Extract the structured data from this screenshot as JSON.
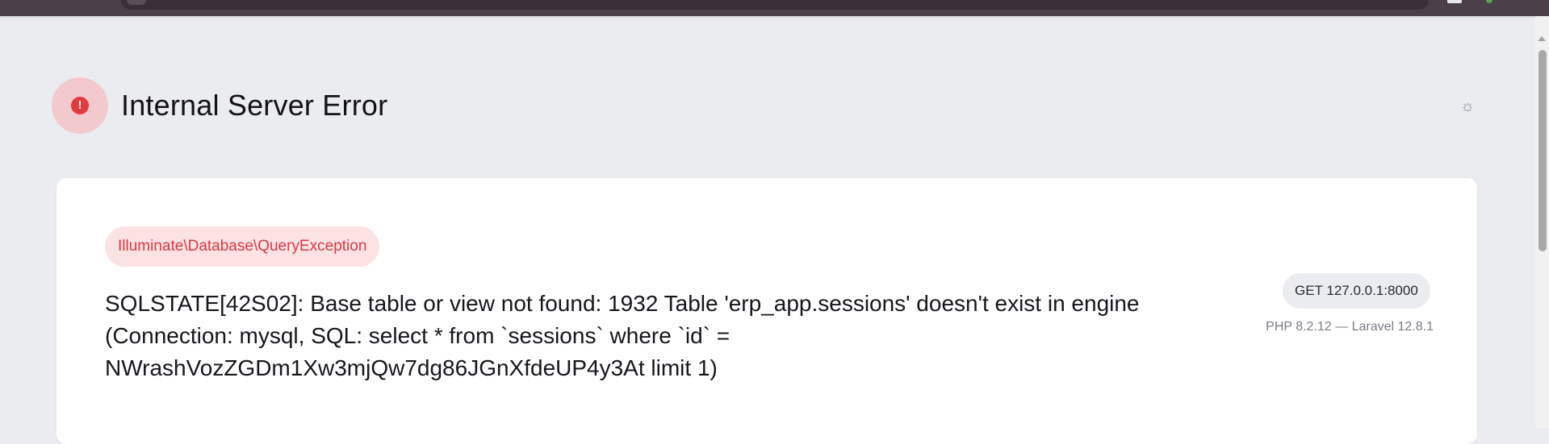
{
  "header": {
    "title": "Internal Server Error",
    "status_icon": "exclamation-icon",
    "status_glyph": "!",
    "theme_icon": "sun-icon",
    "theme_glyph": "☼"
  },
  "exception": {
    "class": "Illuminate\\Database\\QueryException",
    "message": "SQLSTATE[42S02]: Base table or view not found: 1932 Table 'erp_app.sessions' doesn't exist in engine (Connection: mysql, SQL: select * from `sessions` where `id` = NWrashVozZGDm1Xw3mjQw7dg86JGnXfdeUP4y3At limit 1)"
  },
  "request": {
    "summary": "GET 127.0.0.1:8000",
    "versions": "PHP 8.2.12 — Laravel 12.8.1"
  },
  "colors": {
    "background": "#ebecef",
    "error_accent": "#e5383f",
    "error_badge_bg": "#f2c9cd",
    "exception_pill_bg": "#fde2e3",
    "exception_text": "#dc3a45",
    "card_bg": "#ffffff"
  }
}
